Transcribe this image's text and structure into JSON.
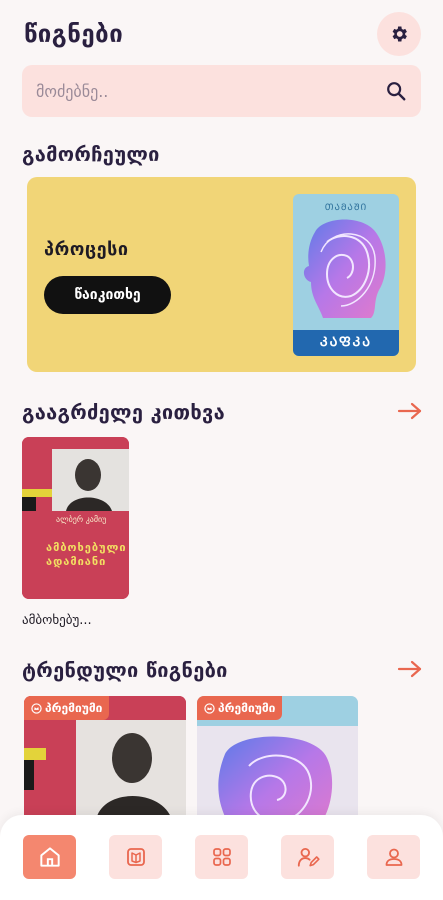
{
  "header": {
    "title": "წიგნები",
    "settings_icon": "gear-icon"
  },
  "search": {
    "placeholder": "მოძებნე..",
    "icon": "search-icon"
  },
  "featured": {
    "section_title": "გამორჩეული",
    "book_name": "პროცესი",
    "read_button": "წაიკითხე",
    "cover_top_label": "ᲗᲐᲛᲐᲨᲘ",
    "cover_bottom_label": "ᲙᲐᲤᲙᲐ"
  },
  "continue_reading": {
    "section_title": "გააგრძელე კითხვა",
    "arrow_icon": "arrow-right-icon",
    "books": [
      {
        "caption": "ამბოხებუ...",
        "cover_title": "ამბოხებული ადამიანი",
        "cover_author": "ალბერ კამიუ"
      }
    ]
  },
  "trending": {
    "section_title": "ტრენდული წიგნები",
    "arrow_icon": "arrow-right-icon",
    "books": [
      {
        "badge": "პრემიუმი",
        "badge_icon": "crown-icon"
      },
      {
        "badge": "პრემიუმი",
        "badge_icon": "crown-icon"
      }
    ]
  },
  "bottom_nav": {
    "items": [
      {
        "icon": "home-icon",
        "active": true
      },
      {
        "icon": "book-icon",
        "active": false
      },
      {
        "icon": "grid-icon",
        "active": false
      },
      {
        "icon": "author-icon",
        "active": false
      },
      {
        "icon": "profile-icon",
        "active": false
      }
    ]
  },
  "colors": {
    "accent": "#F4876F",
    "accent_light": "#FCE1DE",
    "featured_bg": "#F1D577",
    "badge": "#E9674F",
    "text": "#2A2040"
  }
}
